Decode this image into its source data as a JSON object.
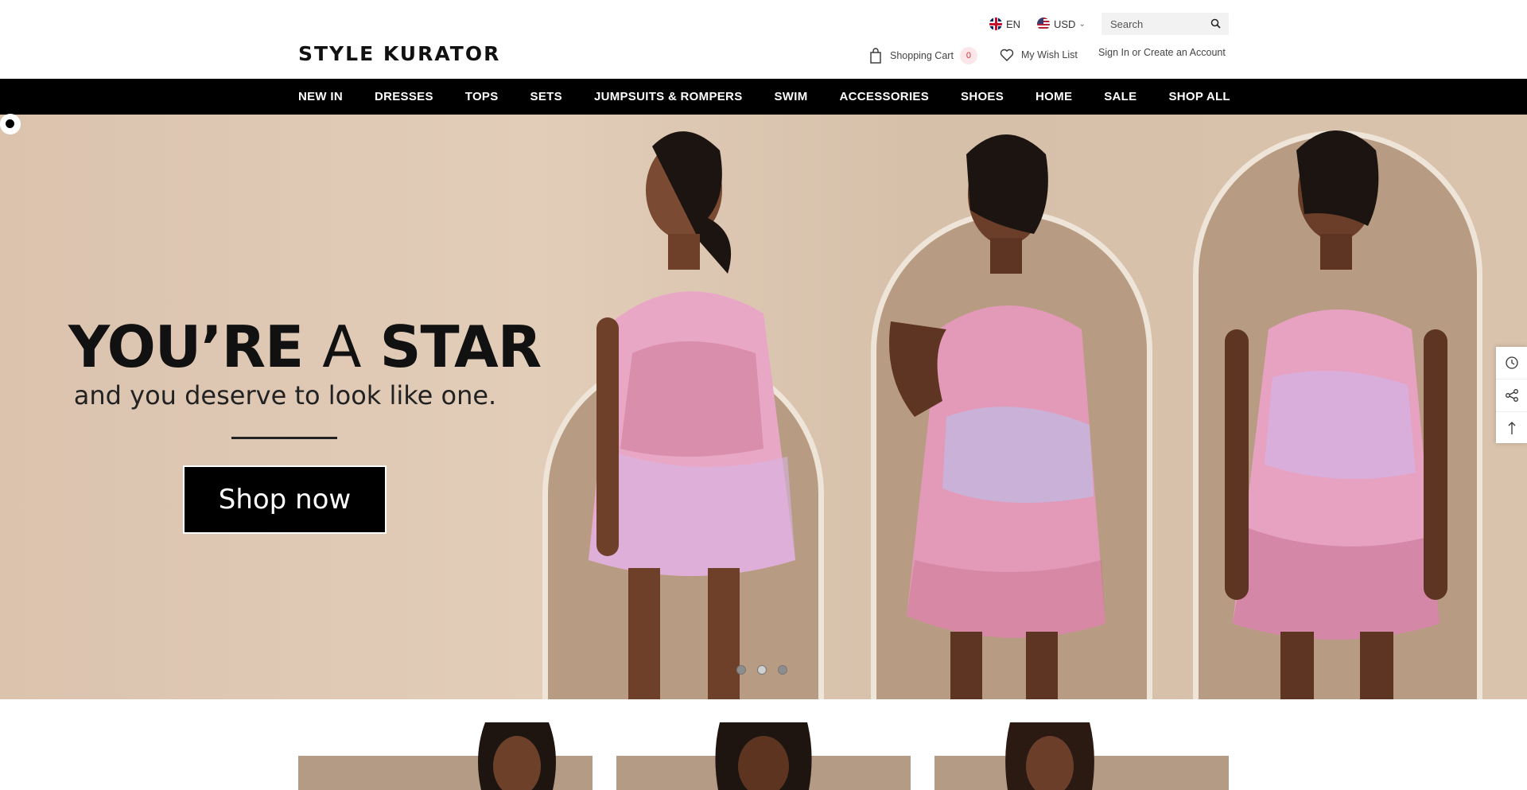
{
  "header": {
    "logo": "STYLE KURATOR",
    "language": "EN",
    "currency": "USD",
    "search_placeholder": "Search",
    "cart_label": "Shopping Cart",
    "cart_count": "0",
    "wishlist_label": "My Wish List",
    "account_label": "Sign In or Create an Account"
  },
  "nav": {
    "items": [
      "NEW IN",
      "DRESSES",
      "TOPS",
      "SETS",
      "JUMPSUITS & ROMPERS",
      "SWIM",
      "ACCESSORIES",
      "SHOES",
      "HOME",
      "SALE",
      "SHOP ALL"
    ]
  },
  "hero": {
    "title_part1": "YOU’RE",
    "title_part2": "A",
    "title_part3": "STAR",
    "subtitle": "and you deserve to look like one.",
    "cta": "Shop now",
    "slide_count": 3,
    "active_slide": 1
  },
  "colors": {
    "nav_bg": "#000000",
    "hero_bg": "#dcc5b0",
    "arch": "#b79c83",
    "dress_pink": "#e9a7c6"
  },
  "side_tools": {
    "icons": [
      "history-icon",
      "share-icon",
      "back-to-top-icon"
    ]
  }
}
